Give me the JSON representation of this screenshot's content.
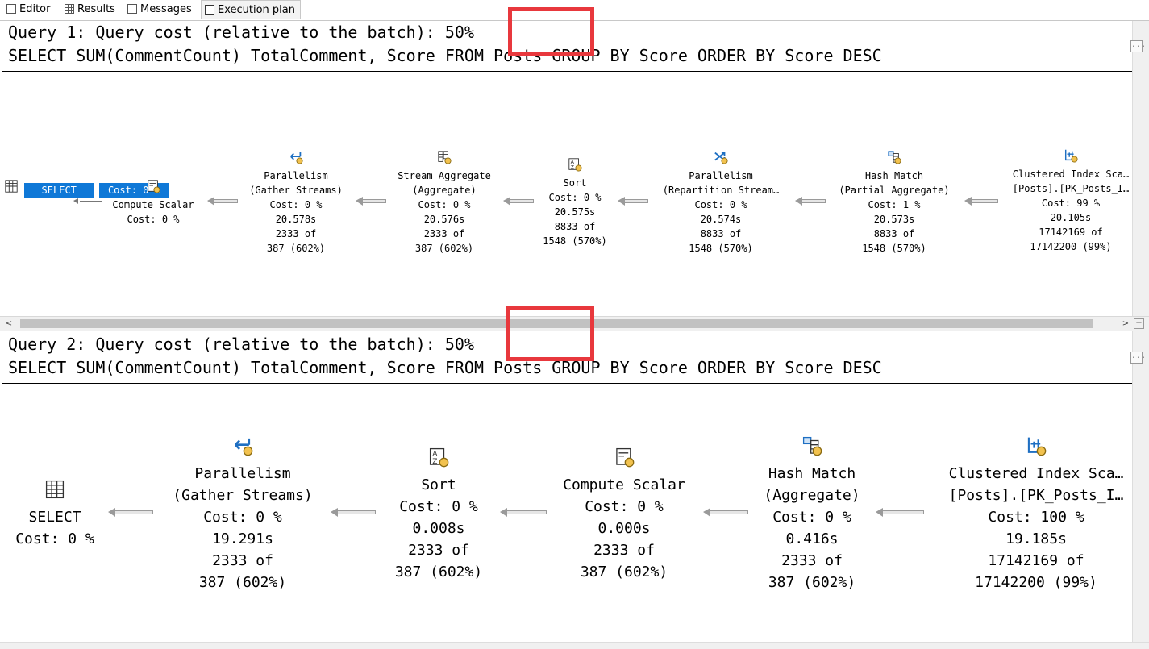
{
  "tabs": [
    {
      "label": "Editor",
      "icon": "editor-icon"
    },
    {
      "label": "Results",
      "icon": "results-grid-icon"
    },
    {
      "label": "Messages",
      "icon": "messages-icon"
    },
    {
      "label": "Execution plan",
      "icon": "execution-plan-icon"
    }
  ],
  "selected_tab": "Execution plan",
  "highlight_color": "#e8383d",
  "selection_color": "#0f78d7",
  "query1": {
    "header_prefix": "Query 1: Query cost (relative to the batch): ",
    "cost": "50%",
    "sql": "SELECT SUM(CommentCount) TotalComment, Score FROM Posts GROUP BY Score ORDER BY Score DESC",
    "operators": [
      {
        "icon": "select-icon",
        "lines": [
          "SELECT",
          "Cost: 0 %"
        ]
      },
      {
        "icon": "compute-scalar-icon",
        "lines": [
          "Compute Scalar",
          "Cost: 0 %"
        ]
      },
      {
        "icon": "parallelism-gather-icon",
        "lines": [
          "Parallelism",
          "(Gather Streams)",
          "Cost: 0 %",
          "20.578s",
          "2333 of",
          "387 (602%)"
        ]
      },
      {
        "icon": "stream-aggregate-icon",
        "lines": [
          "Stream Aggregate",
          "(Aggregate)",
          "Cost: 0 %",
          "20.576s",
          "2333 of",
          "387 (602%)"
        ]
      },
      {
        "icon": "sort-icon",
        "lines": [
          "Sort",
          "Cost: 0 %",
          "20.575s",
          "8833 of",
          "1548 (570%)"
        ]
      },
      {
        "icon": "parallelism-repartition-icon",
        "lines": [
          "Parallelism",
          "(Repartition Stream…",
          "Cost: 0 %",
          "20.574s",
          "8833 of",
          "1548 (570%)"
        ]
      },
      {
        "icon": "hash-match-icon",
        "lines": [
          "Hash Match",
          "(Partial Aggregate)",
          "Cost: 1 %",
          "20.573s",
          "8833 of",
          "1548 (570%)"
        ]
      },
      {
        "icon": "clustered-index-scan-icon",
        "lines": [
          "Clustered Index Sca…",
          "[Posts].[PK_Posts_I…",
          "Cost: 99 %",
          "20.105s",
          "17142169 of",
          "17142200 (99%)"
        ]
      }
    ]
  },
  "query2": {
    "header_prefix": "Query 2: Query cost (relative to the batch): ",
    "cost": "50%",
    "sql": "SELECT SUM(CommentCount) TotalComment, Score FROM Posts GROUP BY Score ORDER BY Score DESC",
    "operators": [
      {
        "icon": "select-icon",
        "lines": [
          "SELECT",
          "Cost: 0 %"
        ]
      },
      {
        "icon": "parallelism-gather-icon",
        "lines": [
          "Parallelism",
          "(Gather Streams)",
          "Cost: 0 %",
          "19.291s",
          "2333 of",
          "387 (602%)"
        ]
      },
      {
        "icon": "sort-icon",
        "lines": [
          "Sort",
          "Cost: 0 %",
          "0.008s",
          "2333 of",
          "387 (602%)"
        ]
      },
      {
        "icon": "compute-scalar-icon",
        "lines": [
          "Compute Scalar",
          "Cost: 0 %",
          "0.000s",
          "2333 of",
          "387 (602%)"
        ]
      },
      {
        "icon": "hash-match-icon",
        "lines": [
          "Hash Match",
          "(Aggregate)",
          "Cost: 0 %",
          "0.416s",
          "2333 of",
          "387 (602%)"
        ]
      },
      {
        "icon": "clustered-index-scan-icon",
        "lines": [
          "Clustered Index Sca…",
          "[Posts].[PK_Posts_I…",
          "Cost: 100 %",
          "19.185s",
          "17142169 of",
          "17142200 (99%)"
        ]
      }
    ]
  },
  "scroll": {
    "left_arrow": "<",
    "right_arrow": ">",
    "plus": "+",
    "collapse": "..."
  }
}
